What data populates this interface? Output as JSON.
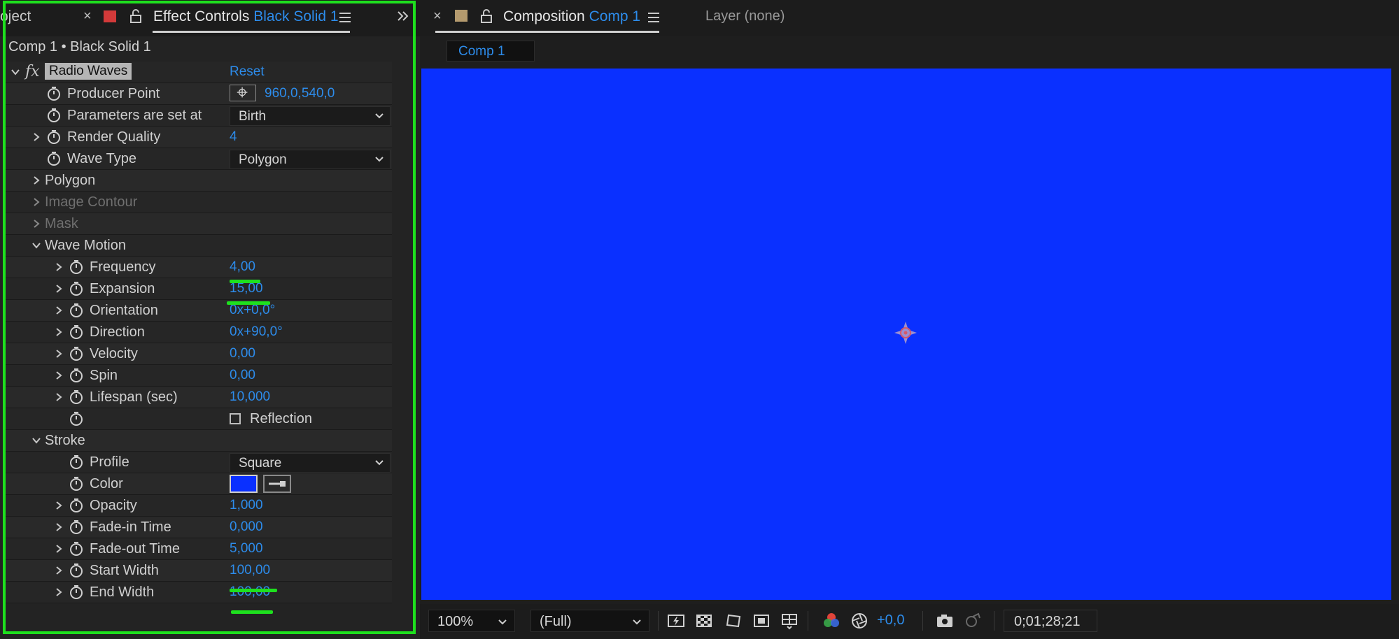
{
  "colors": {
    "accent": "#2d8ceb",
    "highlight": "#1ee01e",
    "viewer_bg": "#0a30ff",
    "solid_swatch": "#d33a3a",
    "comp_swatch": "#b49a6e",
    "stroke_color": "#0a30ff"
  },
  "left_tabs": {
    "project_tab": "oject",
    "effect_controls_label": "Effect Controls",
    "effect_controls_layer": "Black Solid 1"
  },
  "breadcrumb": "Comp 1 • Black Solid 1",
  "effect": {
    "fx_label": "fx",
    "name": "Radio Waves",
    "reset": "Reset"
  },
  "props": {
    "producer_point": {
      "label": "Producer Point",
      "value": "960,0,540,0"
    },
    "parameters_set_at": {
      "label": "Parameters are set at",
      "value": "Birth"
    },
    "render_quality": {
      "label": "Render Quality",
      "value": "4"
    },
    "wave_type": {
      "label": "Wave Type",
      "value": "Polygon"
    },
    "polygon": {
      "label": "Polygon"
    },
    "image_contour": {
      "label": "Image Contour"
    },
    "mask": {
      "label": "Mask"
    },
    "wave_motion": {
      "label": "Wave Motion"
    },
    "frequency": {
      "label": "Frequency",
      "value": "4,00"
    },
    "expansion": {
      "label": "Expansion",
      "value": "15,00"
    },
    "orientation": {
      "label": "Orientation",
      "value": "0x+0,0°"
    },
    "direction": {
      "label": "Direction",
      "value": "0x+90,0°"
    },
    "velocity": {
      "label": "Velocity",
      "value": "0,00"
    },
    "spin": {
      "label": "Spin",
      "value": "0,00"
    },
    "lifespan": {
      "label": "Lifespan (sec)",
      "value": "10,000"
    },
    "reflection": {
      "label": "Reflection",
      "checked": false
    },
    "stroke": {
      "label": "Stroke"
    },
    "profile": {
      "label": "Profile",
      "value": "Square"
    },
    "color": {
      "label": "Color"
    },
    "opacity": {
      "label": "Opacity",
      "value": "1,000"
    },
    "fade_in": {
      "label": "Fade-in Time",
      "value": "0,000"
    },
    "fade_out": {
      "label": "Fade-out Time",
      "value": "5,000"
    },
    "start_width": {
      "label": "Start Width",
      "value": "100,00"
    },
    "end_width": {
      "label": "End Width",
      "value": "100,00"
    }
  },
  "right_tabs": {
    "composition_label": "Composition",
    "composition_name": "Comp 1",
    "layer_tab": "Layer (none)",
    "comp_subtab": "Comp 1"
  },
  "viewer_footer": {
    "zoom": "100%",
    "resolution": "(Full)",
    "exposure": "+0,0",
    "timecode": "0;01;28;21"
  }
}
